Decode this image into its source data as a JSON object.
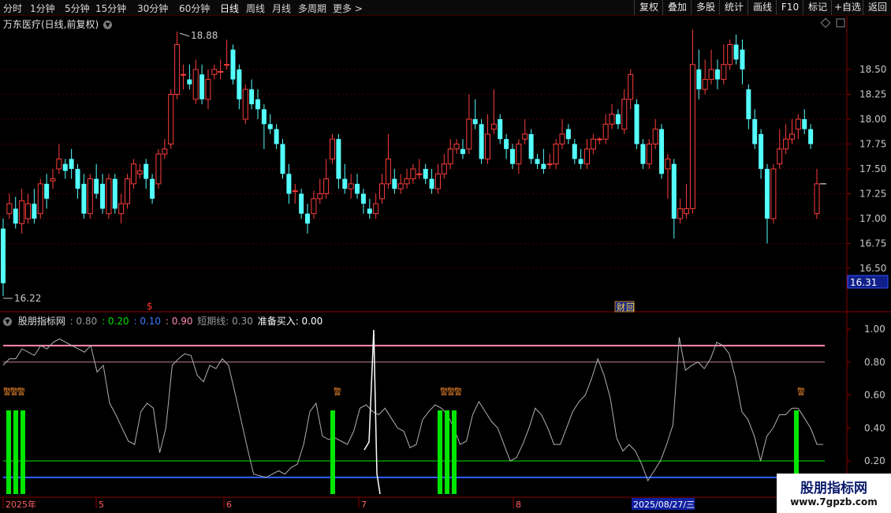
{
  "toolbar": {
    "periods": [
      "分时",
      "1分钟",
      "5分钟",
      "15分钟",
      "30分钟",
      "60分钟",
      "日线",
      "周线",
      "月线",
      "多周期",
      "更多 >"
    ],
    "active_period": "日线",
    "right": [
      "复权",
      "叠加",
      "多股",
      "统计",
      "画线",
      "F10",
      "标记",
      "+自选",
      "返回"
    ]
  },
  "chart_title": "万东医疗(日线,前复权)",
  "price_axis": [
    "18.50",
    "18.25",
    "18.00",
    "17.75",
    "17.50",
    "17.25",
    "17.00",
    "16.75",
    "16.50"
  ],
  "current_price": "16.31",
  "high_label": "18.88",
  "low_label": "16.22",
  "marker_dollar": "$",
  "marker_cai": "财",
  "indicator": {
    "name": "股朋指标网",
    "v1": ": 0.80",
    "v2": ": 0.20",
    "v3": ": 0.10",
    "v4": ": 0.90",
    "short_line": "短期线: 0.30",
    "buy_ready": "准备买入: 0.00",
    "axis": [
      "1.00",
      "0.80",
      "0.60",
      "0.40",
      "0.20"
    ],
    "warn_label": "警"
  },
  "date_axis": [
    "2025年",
    "5",
    "6",
    "7",
    "8",
    "2025/08/27/三"
  ],
  "watermark": {
    "line1": "股朋指标网",
    "line2": "www.7gpzb.com"
  },
  "colors": {
    "up": "#ff3d3d",
    "down": "#54ffff",
    "grid": "#8a0000",
    "pink": "#ff8ab0",
    "green": "#00e600",
    "blue": "#3060ff"
  },
  "chart_data": {
    "type": "candlestick",
    "title": "万东医疗(日线,前复权)",
    "ylim": [
      16.22,
      18.88
    ],
    "candles": [
      [
        16.9,
        16.35,
        17.0,
        16.22
      ],
      [
        17.05,
        17.15,
        17.25,
        17.0
      ],
      [
        17.1,
        16.95,
        17.22,
        16.9
      ],
      [
        16.95,
        17.18,
        17.3,
        16.85
      ],
      [
        17.0,
        17.15,
        17.25,
        16.95
      ],
      [
        17.15,
        17.0,
        17.3,
        16.95
      ],
      [
        17.05,
        17.35,
        17.4,
        17.0
      ],
      [
        17.35,
        17.2,
        17.45,
        17.1
      ],
      [
        17.38,
        17.4,
        17.5,
        17.3
      ],
      [
        17.5,
        17.6,
        17.75,
        17.45
      ],
      [
        17.55,
        17.48,
        17.6,
        17.4
      ],
      [
        17.6,
        17.5,
        17.7,
        17.4
      ],
      [
        17.5,
        17.3,
        17.55,
        17.2
      ],
      [
        17.35,
        17.05,
        17.45,
        17.0
      ],
      [
        17.05,
        17.4,
        17.45,
        17.0
      ],
      [
        17.4,
        17.25,
        17.55,
        17.2
      ],
      [
        17.35,
        17.1,
        17.45,
        17.05
      ],
      [
        17.05,
        17.4,
        17.45,
        17.0
      ],
      [
        17.4,
        17.1,
        17.45,
        17.05
      ],
      [
        17.05,
        17.15,
        17.25,
        16.95
      ],
      [
        17.15,
        17.4,
        17.45,
        17.1
      ],
      [
        17.35,
        17.55,
        17.6,
        17.3
      ],
      [
        17.45,
        17.48,
        17.55,
        17.4
      ],
      [
        17.55,
        17.4,
        17.6,
        17.3
      ],
      [
        17.4,
        17.2,
        17.45,
        17.15
      ],
      [
        17.35,
        17.65,
        17.7,
        17.3
      ],
      [
        17.65,
        17.7,
        17.8,
        17.6
      ],
      [
        17.75,
        18.25,
        18.3,
        17.7
      ],
      [
        18.25,
        18.75,
        18.88,
        18.2
      ],
      [
        18.45,
        18.45,
        18.55,
        18.3
      ],
      [
        18.4,
        18.35,
        18.55,
        18.3
      ],
      [
        18.2,
        18.5,
        18.6,
        18.15
      ],
      [
        18.45,
        18.2,
        18.55,
        18.15
      ],
      [
        18.2,
        18.4,
        18.5,
        18.1
      ],
      [
        18.45,
        18.5,
        18.55,
        18.4
      ],
      [
        18.48,
        18.48,
        18.6,
        18.4
      ],
      [
        18.55,
        18.55,
        18.8,
        18.5
      ],
      [
        18.7,
        18.4,
        18.75,
        18.35
      ],
      [
        18.5,
        18.2,
        18.55,
        18.1
      ],
      [
        18.0,
        18.3,
        18.35,
        17.95
      ],
      [
        18.3,
        18.15,
        18.4,
        18.1
      ],
      [
        18.2,
        18.1,
        18.3,
        18.0
      ],
      [
        18.1,
        17.95,
        18.15,
        17.7
      ],
      [
        17.95,
        17.9,
        18.05,
        17.85
      ],
      [
        17.9,
        17.75,
        17.95,
        17.7
      ],
      [
        17.75,
        17.45,
        17.8,
        17.4
      ],
      [
        17.45,
        17.25,
        17.55,
        17.15
      ],
      [
        17.28,
        17.28,
        17.35,
        17.15
      ],
      [
        17.25,
        17.05,
        17.3,
        17.0
      ],
      [
        17.05,
        16.95,
        17.15,
        16.85
      ],
      [
        17.05,
        17.2,
        17.28,
        17.0
      ],
      [
        17.2,
        17.25,
        17.4,
        17.15
      ],
      [
        17.25,
        17.4,
        17.6,
        17.2
      ],
      [
        17.6,
        17.8,
        17.85,
        17.55
      ],
      [
        17.8,
        17.4,
        17.85,
        17.3
      ],
      [
        17.4,
        17.3,
        17.55,
        17.25
      ],
      [
        17.3,
        17.35,
        17.45,
        17.2
      ],
      [
        17.35,
        17.25,
        17.45,
        17.2
      ],
      [
        17.25,
        17.15,
        17.3,
        17.05
      ],
      [
        17.1,
        17.05,
        17.2,
        17.0
      ],
      [
        17.05,
        17.15,
        17.25,
        17.0
      ],
      [
        17.2,
        17.35,
        17.45,
        17.15
      ],
      [
        17.35,
        17.6,
        17.85,
        17.3
      ],
      [
        17.4,
        17.3,
        17.5,
        17.25
      ],
      [
        17.3,
        17.35,
        17.45,
        17.25
      ],
      [
        17.35,
        17.4,
        17.5,
        17.3
      ],
      [
        17.4,
        17.5,
        17.55,
        17.35
      ],
      [
        17.45,
        17.45,
        17.6,
        17.4
      ],
      [
        17.5,
        17.4,
        17.55,
        17.35
      ],
      [
        17.4,
        17.3,
        17.5,
        17.25
      ],
      [
        17.3,
        17.45,
        17.55,
        17.25
      ],
      [
        17.45,
        17.55,
        17.65,
        17.4
      ],
      [
        17.55,
        17.7,
        17.8,
        17.5
      ],
      [
        17.7,
        17.75,
        17.8,
        17.65
      ],
      [
        17.7,
        17.65,
        17.8,
        17.6
      ],
      [
        17.7,
        18.0,
        18.25,
        17.65
      ],
      [
        18.0,
        17.95,
        18.2,
        17.9
      ],
      [
        17.95,
        17.6,
        18.0,
        17.55
      ],
      [
        17.6,
        17.85,
        18.05,
        17.55
      ],
      [
        17.9,
        17.95,
        18.3,
        17.85
      ],
      [
        18.0,
        17.8,
        18.05,
        17.75
      ],
      [
        17.8,
        17.7,
        17.85,
        17.6
      ],
      [
        17.7,
        17.55,
        17.75,
        17.5
      ],
      [
        17.55,
        17.75,
        17.8,
        17.45
      ],
      [
        17.8,
        17.85,
        18.0,
        17.75
      ],
      [
        17.85,
        17.6,
        17.9,
        17.55
      ],
      [
        17.6,
        17.55,
        17.65,
        17.5
      ],
      [
        17.55,
        17.5,
        17.7,
        17.45
      ],
      [
        17.55,
        17.55,
        17.65,
        17.5
      ],
      [
        17.55,
        17.75,
        17.8,
        17.5
      ],
      [
        17.75,
        17.85,
        18.0,
        17.7
      ],
      [
        17.9,
        17.8,
        17.95,
        17.75
      ],
      [
        17.75,
        17.6,
        17.8,
        17.55
      ],
      [
        17.6,
        17.55,
        17.7,
        17.5
      ],
      [
        17.55,
        17.7,
        17.8,
        17.5
      ],
      [
        17.7,
        17.8,
        17.85,
        17.65
      ],
      [
        17.8,
        17.8,
        17.82,
        17.75
      ],
      [
        17.8,
        17.95,
        18.05,
        17.75
      ],
      [
        17.95,
        18.05,
        18.15,
        17.9
      ],
      [
        18.05,
        17.95,
        18.1,
        17.9
      ],
      [
        17.9,
        18.2,
        18.3,
        17.85
      ],
      [
        18.2,
        18.45,
        18.5,
        18.1
      ],
      [
        18.15,
        17.75,
        18.2,
        17.7
      ],
      [
        17.75,
        17.55,
        17.8,
        17.5
      ],
      [
        17.55,
        17.75,
        17.8,
        17.5
      ],
      [
        17.75,
        17.9,
        18.0,
        17.7
      ],
      [
        17.9,
        17.45,
        17.95,
        17.4
      ],
      [
        17.5,
        17.6,
        17.65,
        17.2
      ],
      [
        17.55,
        17.0,
        17.6,
        16.8
      ],
      [
        17.0,
        17.1,
        17.2,
        16.95
      ],
      [
        17.05,
        17.1,
        17.35,
        17.0
      ],
      [
        17.1,
        18.55,
        18.9,
        17.05
      ],
      [
        18.5,
        18.3,
        18.7,
        18.2
      ],
      [
        18.3,
        18.4,
        18.6,
        18.25
      ],
      [
        18.4,
        18.5,
        18.7,
        18.35
      ],
      [
        18.5,
        18.4,
        18.6,
        18.3
      ],
      [
        18.4,
        18.55,
        18.75,
        18.35
      ],
      [
        18.55,
        18.75,
        18.8,
        18.5
      ],
      [
        18.75,
        18.6,
        18.85,
        18.55
      ],
      [
        18.7,
        18.5,
        18.8,
        18.35
      ],
      [
        18.3,
        18.0,
        18.35,
        17.9
      ],
      [
        18.0,
        17.75,
        18.1,
        17.7
      ],
      [
        17.85,
        17.5,
        17.9,
        17.4
      ],
      [
        17.5,
        17.0,
        17.55,
        16.75
      ],
      [
        17.0,
        17.5,
        17.55,
        16.95
      ],
      [
        17.55,
        17.7,
        17.9,
        17.5
      ],
      [
        17.7,
        17.8,
        17.95,
        17.65
      ],
      [
        17.8,
        17.85,
        18.0,
        17.75
      ],
      [
        17.9,
        18.0,
        18.05,
        17.8
      ],
      [
        18.0,
        17.9,
        18.1,
        17.85
      ],
      [
        17.9,
        17.75,
        17.95,
        17.7
      ],
      [
        17.05,
        17.35,
        17.5,
        17.0
      ]
    ]
  }
}
